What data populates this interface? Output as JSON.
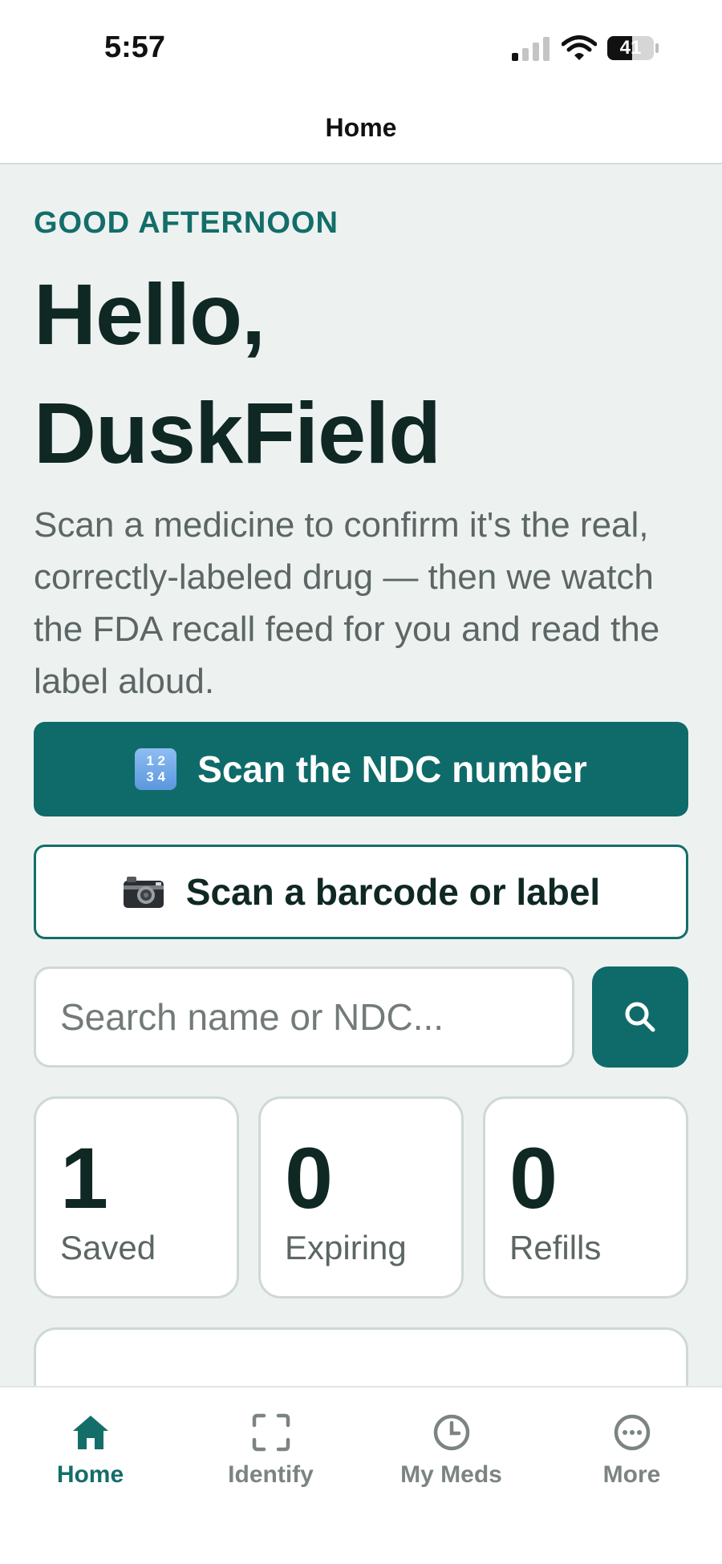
{
  "status_bar": {
    "time": "5:57",
    "battery": "41"
  },
  "header": {
    "title": "Home"
  },
  "hero": {
    "greeting": "GOOD AFTERNOON",
    "hello_line1": "Hello,",
    "hello_line2": "DuskField",
    "intro": "Scan a medicine to confirm it's the real, correctly-labeled drug — then we watch the FDA recall feed for you and read the label aloud."
  },
  "actions": {
    "scan_ndc_label": "Scan the NDC number",
    "scan_ndc_icon_top": "1 2",
    "scan_ndc_icon_bottom": "3 4",
    "scan_barcode_label": "Scan a barcode or label"
  },
  "search": {
    "placeholder": "Search name or NDC..."
  },
  "stats": [
    {
      "value": "1",
      "label": "Saved"
    },
    {
      "value": "0",
      "label": "Expiring"
    },
    {
      "value": "0",
      "label": "Refills"
    }
  ],
  "tabs": [
    {
      "label": "Home",
      "icon": "home-icon",
      "active": true
    },
    {
      "label": "Identify",
      "icon": "scan-frame-icon",
      "active": false
    },
    {
      "label": "My Meds",
      "icon": "clock-icon",
      "active": false
    },
    {
      "label": "More",
      "icon": "more-icon",
      "active": false
    }
  ],
  "colors": {
    "brand": "#0f6b69",
    "background": "#edf2f1",
    "text": "#102824",
    "muted": "#5c6664"
  }
}
